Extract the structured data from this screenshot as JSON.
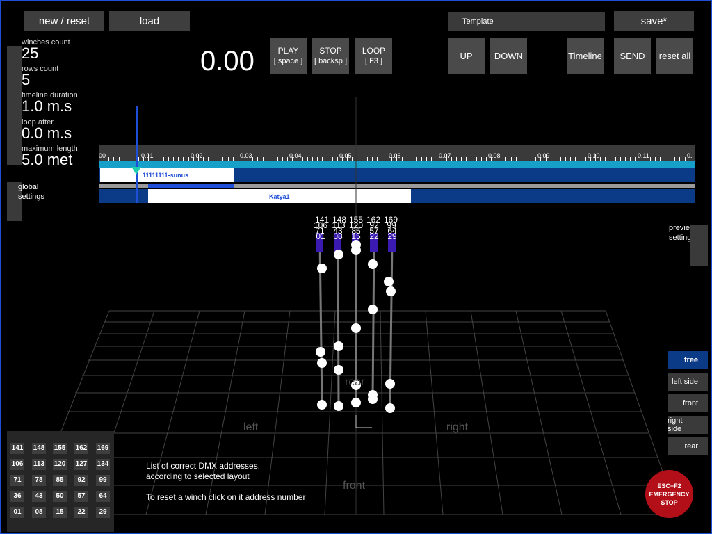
{
  "colors": {
    "accent_blue": "#1f4fd6",
    "track_blue": "#0b3a86",
    "track_cyan": "#16a0c9",
    "emergency_red": "#b30f18",
    "winch_purple": "#3a1ab0"
  },
  "top": {
    "new_reset": "new / reset",
    "load": "load",
    "template": "Template",
    "save": "save*"
  },
  "stats": [
    {
      "label": "winches count",
      "value": "25"
    },
    {
      "label": "rows count",
      "value": "5"
    },
    {
      "label": "timeline duration",
      "value": "1.0 m.s"
    },
    {
      "label": "loop after",
      "value": "0.0 m.s"
    },
    {
      "label": "maximum length",
      "value": "5.0 met"
    }
  ],
  "timer": "0.00",
  "transport": {
    "play": {
      "line1": "PLAY",
      "line2": "[ space ]"
    },
    "stop": {
      "line1": "STOP",
      "line2": "[ backsp ]"
    },
    "loop": {
      "line1": "LOOP",
      "line2": "[ F3 ]"
    }
  },
  "right_buttons": {
    "up": "UP",
    "down": "DOWN",
    "timeline": "Timeline",
    "send": "SEND",
    "reset_all": "reset all"
  },
  "global_settings": "global\nsettings",
  "preview_settings": "preview\nsettings",
  "ruler": [
    "00",
    "0.01",
    "0.02",
    "0.03",
    "0.04",
    "0.05",
    "0.06",
    "0.07",
    "0.08",
    "0.09",
    "0.10",
    "0.11",
    "0."
  ],
  "tracks": {
    "clip1": "11111111-sunus",
    "clip2": "Katya1"
  },
  "winch_labels": [
    [
      "141",
      "106",
      "71",
      "36",
      "01"
    ],
    [
      "148",
      "113",
      "78",
      "43",
      "08"
    ],
    [
      "155",
      "120",
      "85",
      "50",
      "15"
    ],
    [
      "162",
      "127",
      "92",
      "57",
      "22"
    ],
    [
      "169",
      "134",
      "99",
      "64",
      "29"
    ]
  ],
  "axes": {
    "left": "left",
    "right": "right",
    "front": "front",
    "rear": "rear"
  },
  "view_buttons": [
    "free",
    "left side",
    "front",
    "right side",
    "rear"
  ],
  "active_view": "free",
  "dmx_grid": [
    [
      "141",
      "148",
      "155",
      "162",
      "169"
    ],
    [
      "106",
      "113",
      "120",
      "127",
      "134"
    ],
    [
      "71",
      "78",
      "85",
      "92",
      "99"
    ],
    [
      "36",
      "43",
      "50",
      "57",
      "64"
    ],
    [
      "01",
      "08",
      "15",
      "22",
      "29"
    ]
  ],
  "info": {
    "line1": "List of correct DMX addresses,",
    "line2": "according to selected layout",
    "line3": "To reset a winch click on it address number"
  },
  "emergency": {
    "line1": "ESC+F2",
    "line2": "EMERGENCY",
    "line3": "STOP"
  }
}
